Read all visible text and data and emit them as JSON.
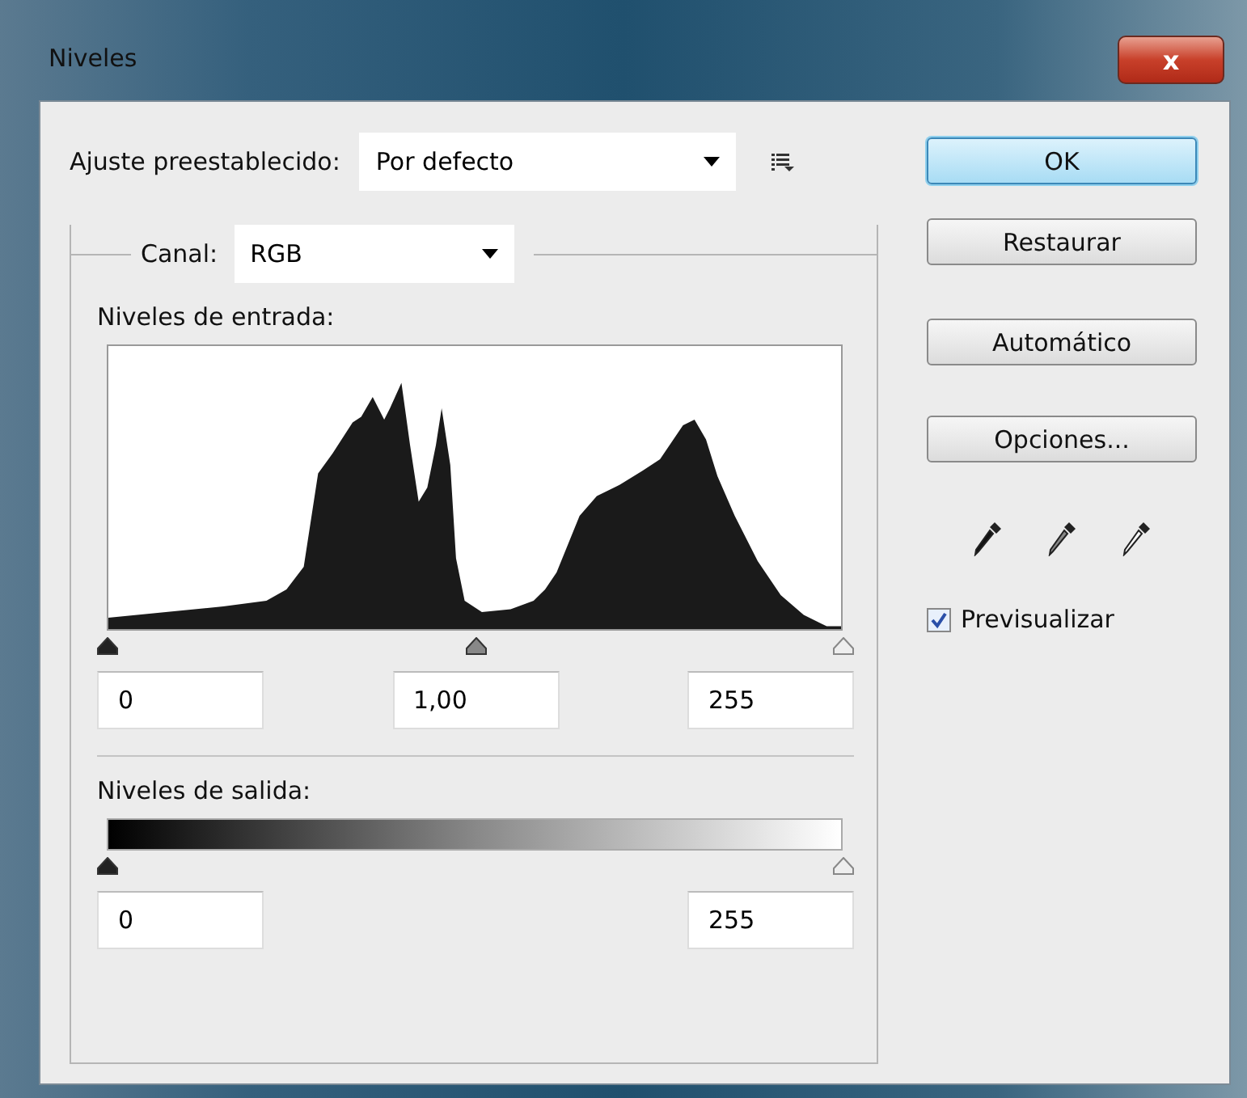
{
  "window": {
    "title": "Niveles",
    "close": "x"
  },
  "preset": {
    "label": "Ajuste preestablecido:",
    "value": "Por defecto"
  },
  "channel": {
    "label": "Canal:",
    "value": "RGB"
  },
  "input_levels": {
    "label": "Niveles de entrada:",
    "sliders": [
      {
        "kind": "black"
      },
      {
        "kind": "gray"
      },
      {
        "kind": "white"
      }
    ],
    "fields": [
      "0",
      "1,00",
      "255"
    ]
  },
  "output_levels": {
    "label": "Niveles de salida:",
    "sliders": [
      {
        "kind": "black"
      },
      {
        "kind": "white"
      }
    ],
    "fields": [
      "0",
      "255"
    ]
  },
  "buttons": [
    {
      "label": "OK",
      "default": true
    },
    {
      "label": "Restaurar",
      "default": false
    },
    {
      "label": "Automático",
      "default": false
    },
    {
      "label": "Opciones...",
      "default": false
    }
  ],
  "eyedroppers": [
    {
      "kind": "black"
    },
    {
      "kind": "gray"
    },
    {
      "kind": "white"
    }
  ],
  "preview": {
    "label": "Previsualizar",
    "checked": true
  }
}
